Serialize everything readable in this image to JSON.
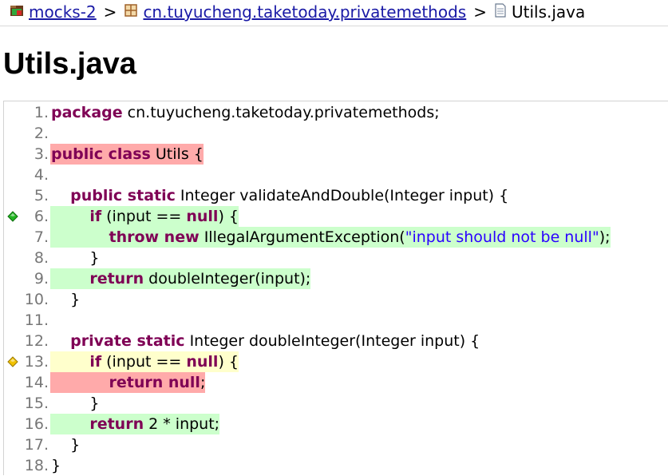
{
  "breadcrumb": {
    "project": "mocks-2",
    "package": "cn.tuyucheng.taketoday.privatemethods",
    "file": "Utils.java",
    "separator": ">"
  },
  "title": "Utils.java",
  "colors": {
    "covered": "#ccffcc",
    "not_covered": "#ffaaaa",
    "partly_covered": "#ffffcc",
    "keyword": "#7f0055",
    "link": "#1a1aa6"
  },
  "lines": [
    {
      "n": "1.",
      "status": "none",
      "marker": "",
      "tokens": [
        {
          "t": "kw",
          "v": "package"
        },
        {
          "t": "p",
          "v": " cn.tuyucheng.taketoday.privatemethods;"
        }
      ]
    },
    {
      "n": "2.",
      "status": "none",
      "marker": "",
      "tokens": []
    },
    {
      "n": "3.",
      "status": "red",
      "marker": "",
      "tokens": [
        {
          "t": "kw",
          "v": "public class"
        },
        {
          "t": "p",
          "v": " Utils {"
        }
      ]
    },
    {
      "n": "4.",
      "status": "none",
      "marker": "",
      "tokens": []
    },
    {
      "n": "5.",
      "status": "none",
      "marker": "",
      "tokens": [
        {
          "t": "p",
          "v": "    "
        },
        {
          "t": "kw",
          "v": "public static"
        },
        {
          "t": "p",
          "v": " Integer validateAndDouble(Integer input) {"
        }
      ]
    },
    {
      "n": "6.",
      "status": "green",
      "marker": "green-diamond",
      "tokens": [
        {
          "t": "p",
          "v": "        "
        },
        {
          "t": "kw",
          "v": "if"
        },
        {
          "t": "p",
          "v": " (input == "
        },
        {
          "t": "kw",
          "v": "null"
        },
        {
          "t": "p",
          "v": ") {"
        }
      ]
    },
    {
      "n": "7.",
      "status": "green",
      "marker": "",
      "tokens": [
        {
          "t": "p",
          "v": "            "
        },
        {
          "t": "kw",
          "v": "throw new"
        },
        {
          "t": "p",
          "v": " IllegalArgumentException("
        },
        {
          "t": "str",
          "v": "\"input should not be null\""
        },
        {
          "t": "p",
          "v": ");"
        }
      ]
    },
    {
      "n": "8.",
      "status": "none",
      "marker": "",
      "tokens": [
        {
          "t": "p",
          "v": "        }"
        }
      ]
    },
    {
      "n": "9.",
      "status": "green",
      "marker": "",
      "tokens": [
        {
          "t": "p",
          "v": "        "
        },
        {
          "t": "kw",
          "v": "return"
        },
        {
          "t": "p",
          "v": " doubleInteger(input);"
        }
      ]
    },
    {
      "n": "10.",
      "status": "none",
      "marker": "",
      "tokens": [
        {
          "t": "p",
          "v": "    }"
        }
      ]
    },
    {
      "n": "11.",
      "status": "none",
      "marker": "",
      "tokens": []
    },
    {
      "n": "12.",
      "status": "none",
      "marker": "",
      "tokens": [
        {
          "t": "p",
          "v": "    "
        },
        {
          "t": "kw",
          "v": "private static"
        },
        {
          "t": "p",
          "v": " Integer doubleInteger(Integer input) {"
        }
      ]
    },
    {
      "n": "13.",
      "status": "yellow",
      "marker": "yellow-diamond",
      "tokens": [
        {
          "t": "p",
          "v": "        "
        },
        {
          "t": "kw",
          "v": "if"
        },
        {
          "t": "p",
          "v": " (input == "
        },
        {
          "t": "kw",
          "v": "null"
        },
        {
          "t": "p",
          "v": ") {"
        }
      ]
    },
    {
      "n": "14.",
      "status": "red",
      "marker": "",
      "tokens": [
        {
          "t": "p",
          "v": "            "
        },
        {
          "t": "kw",
          "v": "return null"
        },
        {
          "t": "p",
          "v": ";"
        }
      ]
    },
    {
      "n": "15.",
      "status": "none",
      "marker": "",
      "tokens": [
        {
          "t": "p",
          "v": "        }"
        }
      ]
    },
    {
      "n": "16.",
      "status": "green",
      "marker": "",
      "tokens": [
        {
          "t": "p",
          "v": "        "
        },
        {
          "t": "kw",
          "v": "return"
        },
        {
          "t": "p",
          "v": " 2 * input;"
        }
      ]
    },
    {
      "n": "17.",
      "status": "none",
      "marker": "",
      "tokens": [
        {
          "t": "p",
          "v": "    }"
        }
      ]
    },
    {
      "n": "18.",
      "status": "none",
      "marker": "",
      "tokens": [
        {
          "t": "p",
          "v": "}"
        }
      ]
    }
  ]
}
